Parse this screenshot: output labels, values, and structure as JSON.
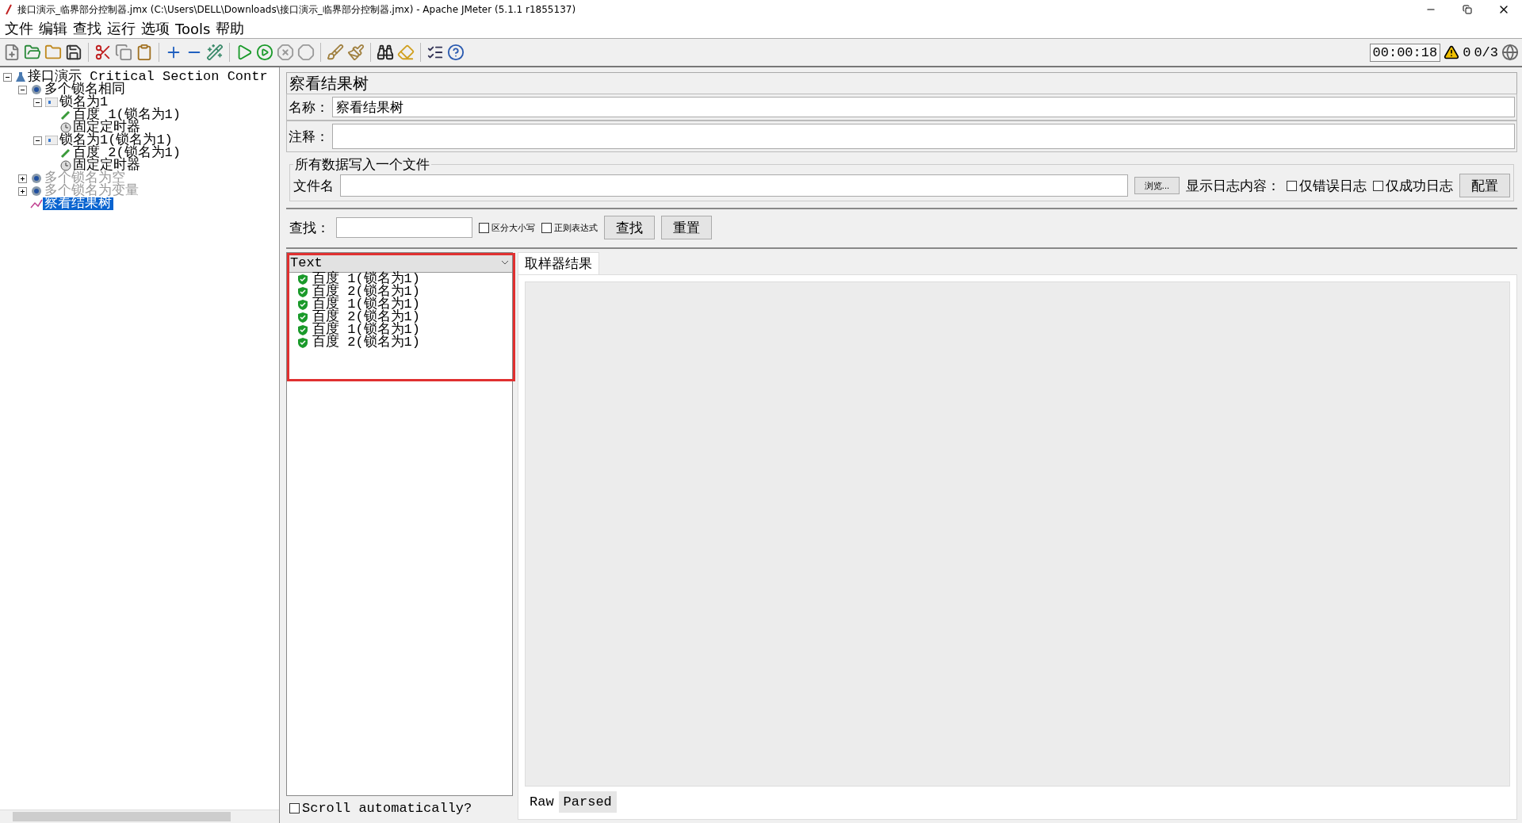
{
  "window": {
    "title": "接口演示_临界部分控制器.jmx (C:\\Users\\DELL\\Downloads\\接口演示_临界部分控制器.jmx) - Apache JMeter (5.1.1 r1855137)"
  },
  "menu": [
    "文件",
    "编辑",
    "查找",
    "运行",
    "选项",
    "Tools",
    "帮助"
  ],
  "status": {
    "timer": "00:00:18",
    "warnings": "0",
    "threads": "0/3"
  },
  "tree": [
    {
      "label": "接口演示 Critical Section Contr",
      "kind": "plan",
      "expanded": true,
      "disabled": false,
      "selected": false,
      "children": [
        {
          "label": "多个锁名相同",
          "kind": "group",
          "expanded": true,
          "disabled": false,
          "selected": false,
          "children": [
            {
              "label": "锁名为1",
              "kind": "controller",
              "expanded": true,
              "disabled": false,
              "selected": false,
              "children": [
                {
                  "label": "百度 1(锁名为1)",
                  "kind": "sampler",
                  "disabled": false,
                  "selected": false
                },
                {
                  "label": "固定定时器",
                  "kind": "timer",
                  "disabled": false,
                  "selected": false
                }
              ]
            },
            {
              "label": "锁名为1(锁名为1)",
              "kind": "controller",
              "expanded": true,
              "disabled": false,
              "selected": false,
              "children": [
                {
                  "label": "百度 2(锁名为1)",
                  "kind": "sampler",
                  "disabled": false,
                  "selected": false
                },
                {
                  "label": "固定定时器",
                  "kind": "timer",
                  "disabled": false,
                  "selected": false
                }
              ]
            }
          ]
        },
        {
          "label": "多个锁名为空",
          "kind": "group",
          "expanded": false,
          "disabled": true,
          "selected": false
        },
        {
          "label": "多个锁名为变量",
          "kind": "group",
          "expanded": false,
          "disabled": true,
          "selected": false
        },
        {
          "label": "察看结果树",
          "kind": "listener",
          "disabled": false,
          "selected": true
        }
      ]
    }
  ],
  "panel": {
    "title": "察看结果树",
    "name_field": {
      "label": "名称：",
      "value": "察看结果树"
    },
    "comment_field": {
      "label": "注释："
    },
    "file_group": {
      "title": "所有数据写入一个文件",
      "file_label": "文件名",
      "browse_button": "浏览...",
      "log_label": "显示日志内容：",
      "checkboxes": [
        {
          "label": "仅错误日志",
          "checked": false
        },
        {
          "label": "仅成功日志",
          "checked": false
        }
      ],
      "config_button": "配置"
    },
    "search": {
      "label": "查找：",
      "options": [
        {
          "label": "区分大小写",
          "checked": false
        },
        {
          "label": "正则表达式",
          "checked": false
        }
      ],
      "buttons": [
        "查找",
        "重置"
      ]
    },
    "results": {
      "renderer": "Text",
      "highlighted": true,
      "items": [
        {
          "label": "百度 1(锁名为1)",
          "success": true
        },
        {
          "label": "百度 2(锁名为1)",
          "success": true
        },
        {
          "label": "百度 1(锁名为1)",
          "success": true
        },
        {
          "label": "百度 2(锁名为1)",
          "success": true
        },
        {
          "label": "百度 1(锁名为1)",
          "success": true
        },
        {
          "label": "百度 2(锁名为1)",
          "success": true
        }
      ],
      "scroll_auto": {
        "label": "Scroll automatically?",
        "checked": false
      }
    },
    "result_tabs": [
      {
        "label": "取样器结果",
        "selected": true
      }
    ],
    "view_tabs": [
      {
        "label": "Raw",
        "selected": true
      },
      {
        "label": "Parsed",
        "selected": false
      }
    ]
  }
}
